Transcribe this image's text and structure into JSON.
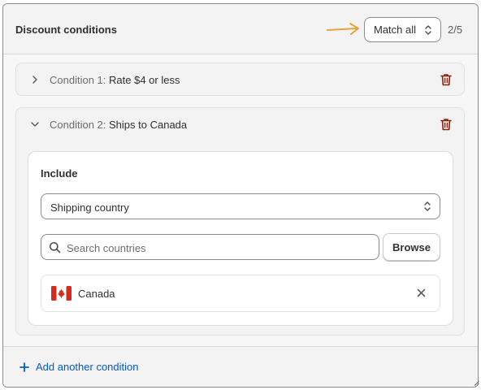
{
  "header": {
    "title": "Discount conditions",
    "match_label": "Match all",
    "counter": "2/5"
  },
  "conditions": [
    {
      "prefix": "Condition 1:",
      "text": "Rate $4 or less",
      "expanded": false
    },
    {
      "prefix": "Condition 2:",
      "text": "Ships to Canada",
      "expanded": true
    }
  ],
  "rule": {
    "include_label": "Include",
    "field_value": "Shipping country",
    "search_placeholder": "Search countries",
    "browse_label": "Browse",
    "selected": [
      {
        "name": "Canada",
        "flag": "canada-flag-icon"
      }
    ]
  },
  "footer": {
    "add_label": "Add another condition"
  },
  "colors": {
    "link": "#005bd3",
    "danger": "#8e1f0b",
    "annotation_arrow": "#e8a33c"
  }
}
